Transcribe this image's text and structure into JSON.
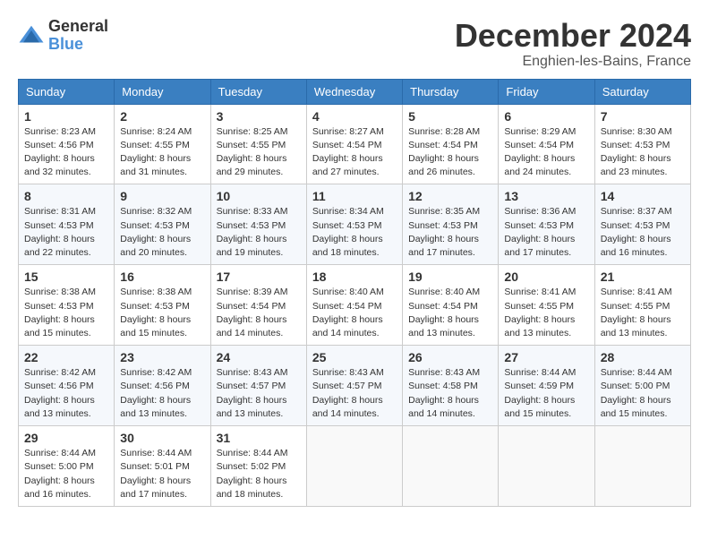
{
  "header": {
    "logo_line1": "General",
    "logo_line2": "Blue",
    "month_title": "December 2024",
    "location": "Enghien-les-Bains, France"
  },
  "days_of_week": [
    "Sunday",
    "Monday",
    "Tuesday",
    "Wednesday",
    "Thursday",
    "Friday",
    "Saturday"
  ],
  "weeks": [
    [
      {
        "day": "1",
        "sunrise": "8:23 AM",
        "sunset": "4:56 PM",
        "daylight": "8 hours and 32 minutes."
      },
      {
        "day": "2",
        "sunrise": "8:24 AM",
        "sunset": "4:55 PM",
        "daylight": "8 hours and 31 minutes."
      },
      {
        "day": "3",
        "sunrise": "8:25 AM",
        "sunset": "4:55 PM",
        "daylight": "8 hours and 29 minutes."
      },
      {
        "day": "4",
        "sunrise": "8:27 AM",
        "sunset": "4:54 PM",
        "daylight": "8 hours and 27 minutes."
      },
      {
        "day": "5",
        "sunrise": "8:28 AM",
        "sunset": "4:54 PM",
        "daylight": "8 hours and 26 minutes."
      },
      {
        "day": "6",
        "sunrise": "8:29 AM",
        "sunset": "4:54 PM",
        "daylight": "8 hours and 24 minutes."
      },
      {
        "day": "7",
        "sunrise": "8:30 AM",
        "sunset": "4:53 PM",
        "daylight": "8 hours and 23 minutes."
      }
    ],
    [
      {
        "day": "8",
        "sunrise": "8:31 AM",
        "sunset": "4:53 PM",
        "daylight": "8 hours and 22 minutes."
      },
      {
        "day": "9",
        "sunrise": "8:32 AM",
        "sunset": "4:53 PM",
        "daylight": "8 hours and 20 minutes."
      },
      {
        "day": "10",
        "sunrise": "8:33 AM",
        "sunset": "4:53 PM",
        "daylight": "8 hours and 19 minutes."
      },
      {
        "day": "11",
        "sunrise": "8:34 AM",
        "sunset": "4:53 PM",
        "daylight": "8 hours and 18 minutes."
      },
      {
        "day": "12",
        "sunrise": "8:35 AM",
        "sunset": "4:53 PM",
        "daylight": "8 hours and 17 minutes."
      },
      {
        "day": "13",
        "sunrise": "8:36 AM",
        "sunset": "4:53 PM",
        "daylight": "8 hours and 17 minutes."
      },
      {
        "day": "14",
        "sunrise": "8:37 AM",
        "sunset": "4:53 PM",
        "daylight": "8 hours and 16 minutes."
      }
    ],
    [
      {
        "day": "15",
        "sunrise": "8:38 AM",
        "sunset": "4:53 PM",
        "daylight": "8 hours and 15 minutes."
      },
      {
        "day": "16",
        "sunrise": "8:38 AM",
        "sunset": "4:53 PM",
        "daylight": "8 hours and 15 minutes."
      },
      {
        "day": "17",
        "sunrise": "8:39 AM",
        "sunset": "4:54 PM",
        "daylight": "8 hours and 14 minutes."
      },
      {
        "day": "18",
        "sunrise": "8:40 AM",
        "sunset": "4:54 PM",
        "daylight": "8 hours and 14 minutes."
      },
      {
        "day": "19",
        "sunrise": "8:40 AM",
        "sunset": "4:54 PM",
        "daylight": "8 hours and 13 minutes."
      },
      {
        "day": "20",
        "sunrise": "8:41 AM",
        "sunset": "4:55 PM",
        "daylight": "8 hours and 13 minutes."
      },
      {
        "day": "21",
        "sunrise": "8:41 AM",
        "sunset": "4:55 PM",
        "daylight": "8 hours and 13 minutes."
      }
    ],
    [
      {
        "day": "22",
        "sunrise": "8:42 AM",
        "sunset": "4:56 PM",
        "daylight": "8 hours and 13 minutes."
      },
      {
        "day": "23",
        "sunrise": "8:42 AM",
        "sunset": "4:56 PM",
        "daylight": "8 hours and 13 minutes."
      },
      {
        "day": "24",
        "sunrise": "8:43 AM",
        "sunset": "4:57 PM",
        "daylight": "8 hours and 13 minutes."
      },
      {
        "day": "25",
        "sunrise": "8:43 AM",
        "sunset": "4:57 PM",
        "daylight": "8 hours and 14 minutes."
      },
      {
        "day": "26",
        "sunrise": "8:43 AM",
        "sunset": "4:58 PM",
        "daylight": "8 hours and 14 minutes."
      },
      {
        "day": "27",
        "sunrise": "8:44 AM",
        "sunset": "4:59 PM",
        "daylight": "8 hours and 15 minutes."
      },
      {
        "day": "28",
        "sunrise": "8:44 AM",
        "sunset": "5:00 PM",
        "daylight": "8 hours and 15 minutes."
      }
    ],
    [
      {
        "day": "29",
        "sunrise": "8:44 AM",
        "sunset": "5:00 PM",
        "daylight": "8 hours and 16 minutes."
      },
      {
        "day": "30",
        "sunrise": "8:44 AM",
        "sunset": "5:01 PM",
        "daylight": "8 hours and 17 minutes."
      },
      {
        "day": "31",
        "sunrise": "8:44 AM",
        "sunset": "5:02 PM",
        "daylight": "8 hours and 18 minutes."
      },
      null,
      null,
      null,
      null
    ]
  ],
  "labels": {
    "sunrise": "Sunrise:",
    "sunset": "Sunset:",
    "daylight": "Daylight:"
  }
}
